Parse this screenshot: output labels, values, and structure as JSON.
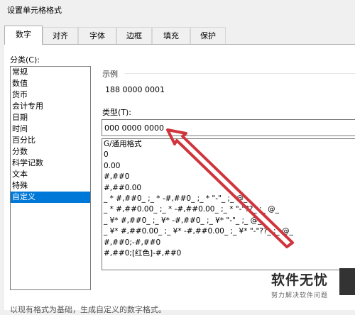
{
  "dialog": {
    "title": "设置单元格格式"
  },
  "tabs": [
    {
      "label": "数字",
      "active": true
    },
    {
      "label": "对齐"
    },
    {
      "label": "字体"
    },
    {
      "label": "边框"
    },
    {
      "label": "填充"
    },
    {
      "label": "保护"
    }
  ],
  "category": {
    "label": "分类(C):",
    "items": [
      "常规",
      "数值",
      "货币",
      "会计专用",
      "日期",
      "时间",
      "百分比",
      "分数",
      "科学记数",
      "文本",
      "特殊",
      "自定义"
    ],
    "selected": "自定义"
  },
  "sample": {
    "label": "示例",
    "value": "188 0000 0001"
  },
  "type": {
    "label": "类型(T):",
    "value": "000 0000 0000",
    "formats": [
      "G/通用格式",
      "0",
      "0.00",
      "#,##0",
      "#,##0.00",
      "_ * #,##0_ ;_ * -#,##0_ ;_ * \"-\"_ ;_ @_",
      "_ * #,##0.00_ ;_ * -#,##0.00_ ;_ * \"-\"??_ ;_ @_",
      "_ ¥* #,##0_ ;_ ¥* -#,##0_ ;_ ¥* \"-\"_ ;_ @_",
      "_ ¥* #,##0.00_ ;_ ¥* -#,##0.00_ ;_ ¥* \"-\"??_ ;_ @_",
      "#,##0;-#,##0",
      "#,##0;[红色]-#,##0"
    ]
  },
  "footer": {
    "note": "以现有格式为基础，生成自定义的数字格式。"
  },
  "watermark": {
    "main": "软件无忧",
    "sub": "努力解决软件问题"
  },
  "colors": {
    "arrow": "#d0343c",
    "selection": "#0078d7"
  }
}
